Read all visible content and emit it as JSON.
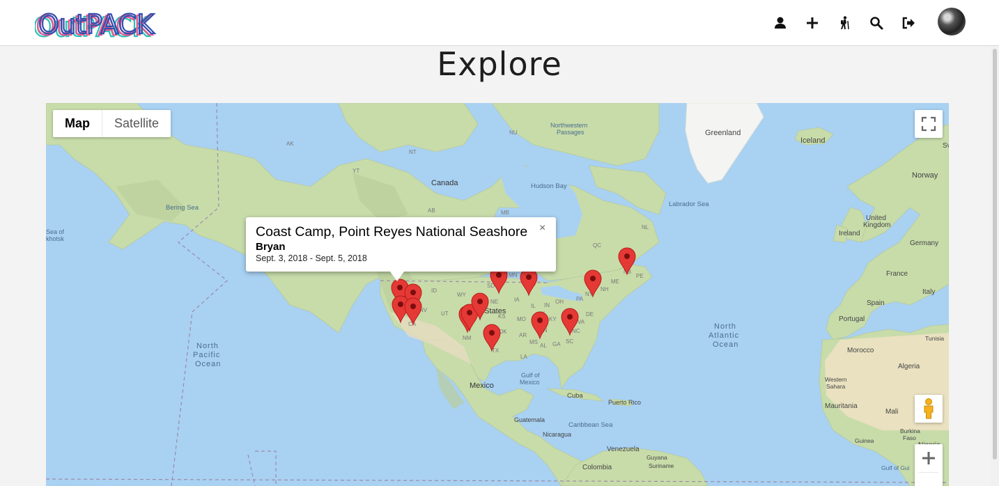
{
  "header": {
    "logo_text": "OutPACK",
    "nav": [
      {
        "name": "profile",
        "icon": "user-icon"
      },
      {
        "name": "add",
        "icon": "plus-icon"
      },
      {
        "name": "hike",
        "icon": "hiker-icon"
      },
      {
        "name": "search",
        "icon": "search-icon"
      },
      {
        "name": "logout",
        "icon": "sign-out-icon"
      }
    ],
    "avatar_icon": "avatar"
  },
  "page": {
    "title": "Explore"
  },
  "map": {
    "type_controls": {
      "map_label": "Map",
      "satellite_label": "Satellite",
      "selected": "Map"
    },
    "controls": [
      "fullscreen-icon",
      "pegman-icon",
      "zoom-in-icon"
    ],
    "labels": {
      "greenland": "Greenland",
      "iceland": "Iceland",
      "norway": "Norway",
      "canada": "Canada",
      "hudson_bay": "Hudson Bay",
      "labrador_sea": "Labrador Sea",
      "bering_sea": "Bering Sea",
      "northwestern_passages_1": "Northwestern",
      "northwestern_passages_2": "Passages",
      "north_pacific_1": "North",
      "north_pacific_2": "Pacific",
      "north_pacific_3": "Ocean",
      "north_atlantic_1": "North",
      "north_atlantic_2": "Atlantic",
      "north_atlantic_3": "Ocean",
      "united_states": "d States",
      "mexico": "Mexico",
      "gulf_of_mexico_1": "Gulf of",
      "gulf_of_mexico_2": "Mexico",
      "cuba": "Cuba",
      "puerto_rico": "Puerto Rico",
      "guatemala": "Guatemala",
      "nicaragua": "Nicaragua",
      "caribbean_sea": "Caribbean Sea",
      "venezuela": "Venezuela",
      "colombia": "Colombia",
      "guyana": "Guyana",
      "suriname": "Suriname",
      "ireland": "Ireland",
      "united_kingdom_1": "United",
      "united_kingdom_2": "Kingdom",
      "germany": "Germany",
      "france": "France",
      "spain": "Spain",
      "portugal": "Portugal",
      "italy": "Italy",
      "morocco": "Morocco",
      "algeria": "Algeria",
      "tunisia": "Tunisia",
      "western_sahara_1": "Western",
      "western_sahara_2": "Sahara",
      "mauritania": "Mauritania",
      "mali": "Mali",
      "burkina_faso_1": "Burkina",
      "burkina_faso_2": "Faso",
      "guinea": "Guinea",
      "nigeria": "Nigeria",
      "gulf_of_guinea": "Gulf of Gui",
      "sea_of_okhotsk_1": "Sea of",
      "sea_of_okhotsk_2": "khotsk",
      "ak": "AK",
      "nu": "NU",
      "nt": "NT",
      "yt": "YT",
      "ab": "AB",
      "mb": "MB",
      "nl": "NL",
      "qc": "QC",
      "nb": "NB",
      "pe": "PE",
      "mn": "MN",
      "wi": "WI",
      "me": "ME",
      "nh": "NH",
      "ny": "NY",
      "sd": "SD",
      "ne": "NE",
      "ia": "IA",
      "wy": "WY",
      "id": "ID",
      "nv": "NV",
      "ut": "UT",
      "ca": "CA",
      "nm": "NM",
      "ok": "OK",
      "tx": "TX",
      "ks": "KS",
      "mo": "MO",
      "il": "IL",
      "in": "IN",
      "oh": "OH",
      "pa": "PA",
      "de": "DE",
      "ky": "KY",
      "va": "VA",
      "tn": "TN",
      "nc": "NC",
      "sc": "SC",
      "ms": "MS",
      "al": "AL",
      "ga": "GA",
      "la": "LA",
      "ar": "AR",
      "ar2": "AR",
      "w": "W",
      "sv": "Sv"
    },
    "info_window": {
      "title": "Coast Camp, Point Reyes National Seashore",
      "author": "Bryan",
      "dates": "Sept. 3, 2018 - Sept. 5, 2018",
      "close_label": "×"
    },
    "marker_icon": "map-pin-icon",
    "marker_color": "#e53935"
  }
}
